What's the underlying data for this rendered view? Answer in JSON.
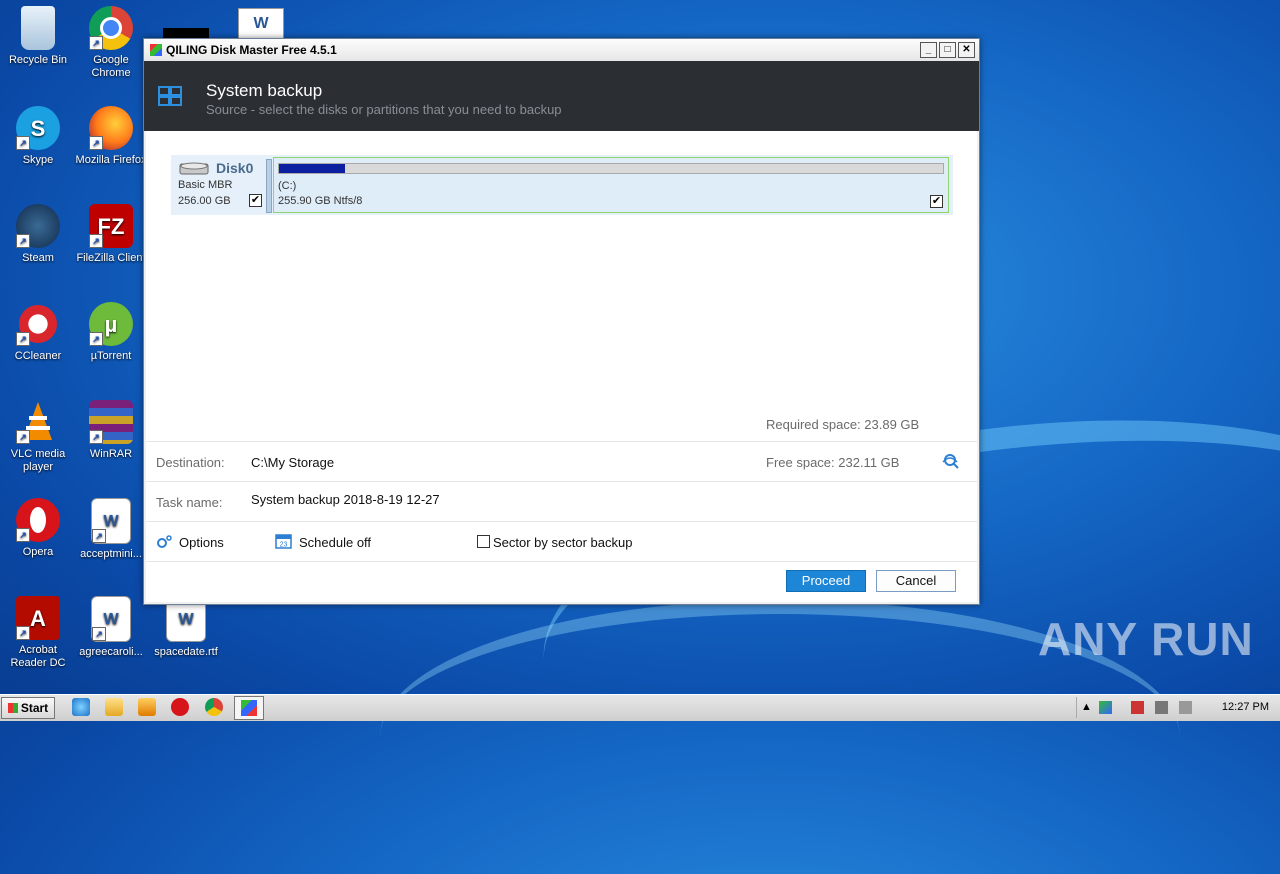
{
  "desktop": {
    "icons": [
      {
        "label": "Recycle Bin"
      },
      {
        "label": "Google Chrome"
      },
      {
        "label": "Skype"
      },
      {
        "label": "Mozilla Firefox"
      },
      {
        "label": "Steam"
      },
      {
        "label": "FileZilla Client"
      },
      {
        "label": "CCleaner"
      },
      {
        "label": "µTorrent"
      },
      {
        "label": "VLC media player"
      },
      {
        "label": "WinRAR"
      },
      {
        "label": "Opera"
      },
      {
        "label": "acceptmini..."
      },
      {
        "label": "Acrobat Reader DC"
      },
      {
        "label": "agreecaroli..."
      },
      {
        "label": "spacedate.rtf"
      }
    ],
    "watermark": "ANY RUN"
  },
  "window": {
    "title": "QILING Disk Master Free 4.5.1",
    "controls": {
      "minimize": "_",
      "maximize": "□",
      "close": "✕"
    },
    "header": {
      "title": "System backup",
      "subtitle": "Source - select the disks or partitions that you need to backup"
    },
    "disk": {
      "name": "Disk0",
      "type": "Basic MBR",
      "size": "256.00 GB",
      "checked": "✔",
      "partition": {
        "label": "(C:)",
        "size": "255.90 GB Ntfs/8",
        "checked": "✔",
        "used_fraction": 0.1
      }
    },
    "required_space": "Required space: 23.89 GB",
    "destination": {
      "label": "Destination:",
      "value": "C:\\My Storage",
      "free_space": "Free space: 232.11 GB"
    },
    "task": {
      "label": "Task name:",
      "value": "System backup 2018-8-19 12-27"
    },
    "options": {
      "options_label": "Options",
      "schedule_label": "Schedule off",
      "sector_label": "Sector by sector backup"
    },
    "buttons": {
      "proceed": "Proceed",
      "cancel": "Cancel"
    }
  },
  "taskbar": {
    "start_label": "Start",
    "clock": "12:27 PM"
  },
  "colors": {
    "accent": "#1e86d6",
    "header_bg": "#2b2e33",
    "usage_fill": "#0b1fa0"
  }
}
